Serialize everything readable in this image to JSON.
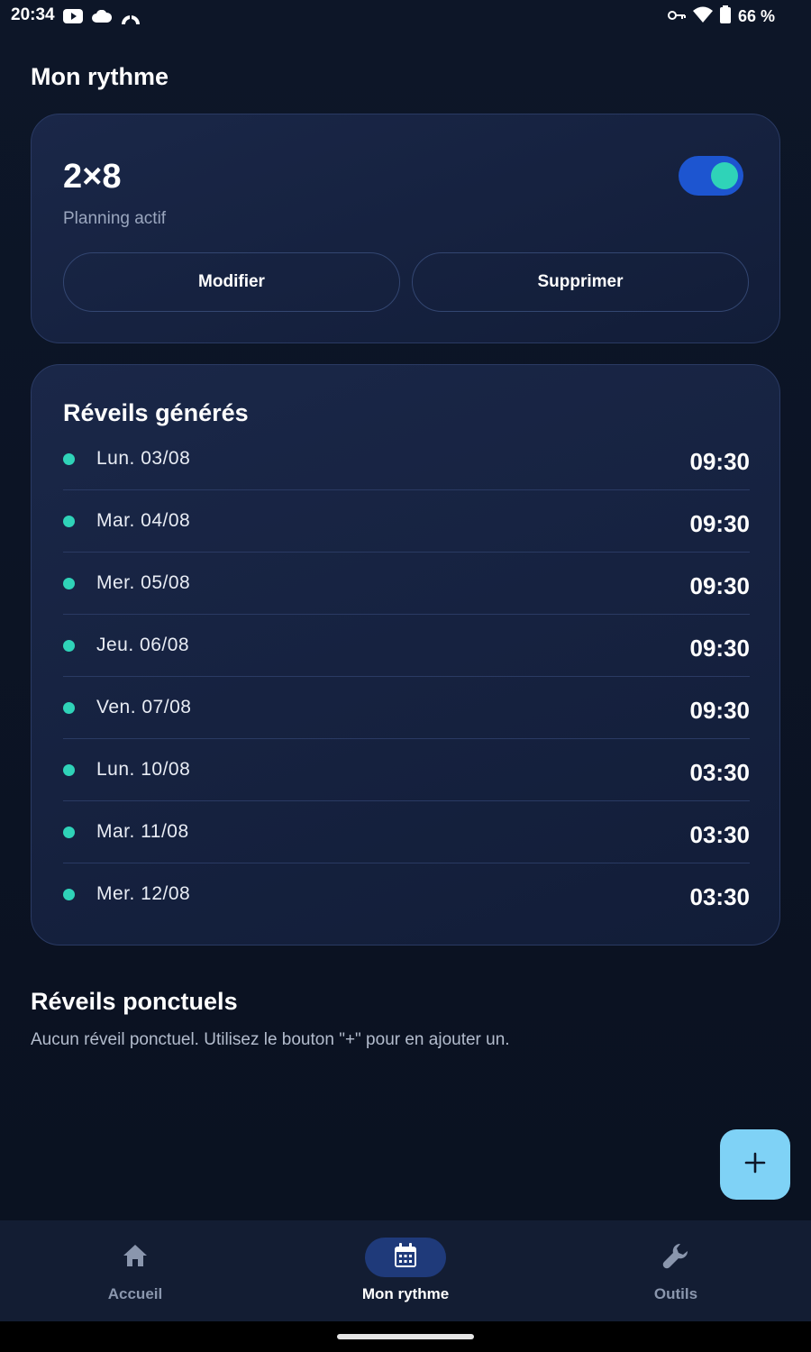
{
  "status_bar": {
    "time": "20:34",
    "left_icons": [
      "youtube-icon",
      "cloud-icon",
      "app-arch-icon"
    ],
    "right_icons": [
      "vpn-key-icon",
      "wifi-icon",
      "battery-icon"
    ],
    "battery_text": "66 %"
  },
  "page_title": "Mon rythme",
  "rhythm_card": {
    "name": "2×8",
    "status": "Planning actif",
    "toggle_on": true,
    "modify_label": "Modifier",
    "delete_label": "Supprimer"
  },
  "alarms": {
    "title": "Réveils générés",
    "items": [
      {
        "day": "Lun. 03/08",
        "time": "09:30"
      },
      {
        "day": "Mar. 04/08",
        "time": "09:30"
      },
      {
        "day": "Mer. 05/08",
        "time": "09:30"
      },
      {
        "day": "Jeu. 06/08",
        "time": "09:30"
      },
      {
        "day": "Ven. 07/08",
        "time": "09:30"
      },
      {
        "day": "Lun. 10/08",
        "time": "03:30"
      },
      {
        "day": "Mar. 11/08",
        "time": "03:30"
      },
      {
        "day": "Mer. 12/08",
        "time": "03:30"
      }
    ]
  },
  "oneoff": {
    "title": "Réveils ponctuels",
    "empty_text": "Aucun réveil ponctuel. Utilisez le bouton \"+\" pour en ajouter un."
  },
  "fab": {
    "icon": "plus-icon"
  },
  "bottom_nav": {
    "items": [
      {
        "label": "Accueil",
        "icon": "home-icon",
        "active": false
      },
      {
        "label": "Mon rythme",
        "icon": "calendar-icon",
        "active": true
      },
      {
        "label": "Outils",
        "icon": "wrench-icon",
        "active": false
      }
    ]
  },
  "colors": {
    "background": "#0b1220",
    "card": "#1a2748",
    "accent_teal": "#2fd3b8",
    "toggle_blue": "#1d55d0",
    "fab": "#7fd2f6",
    "nav_active_pill": "#1f3a7a"
  }
}
